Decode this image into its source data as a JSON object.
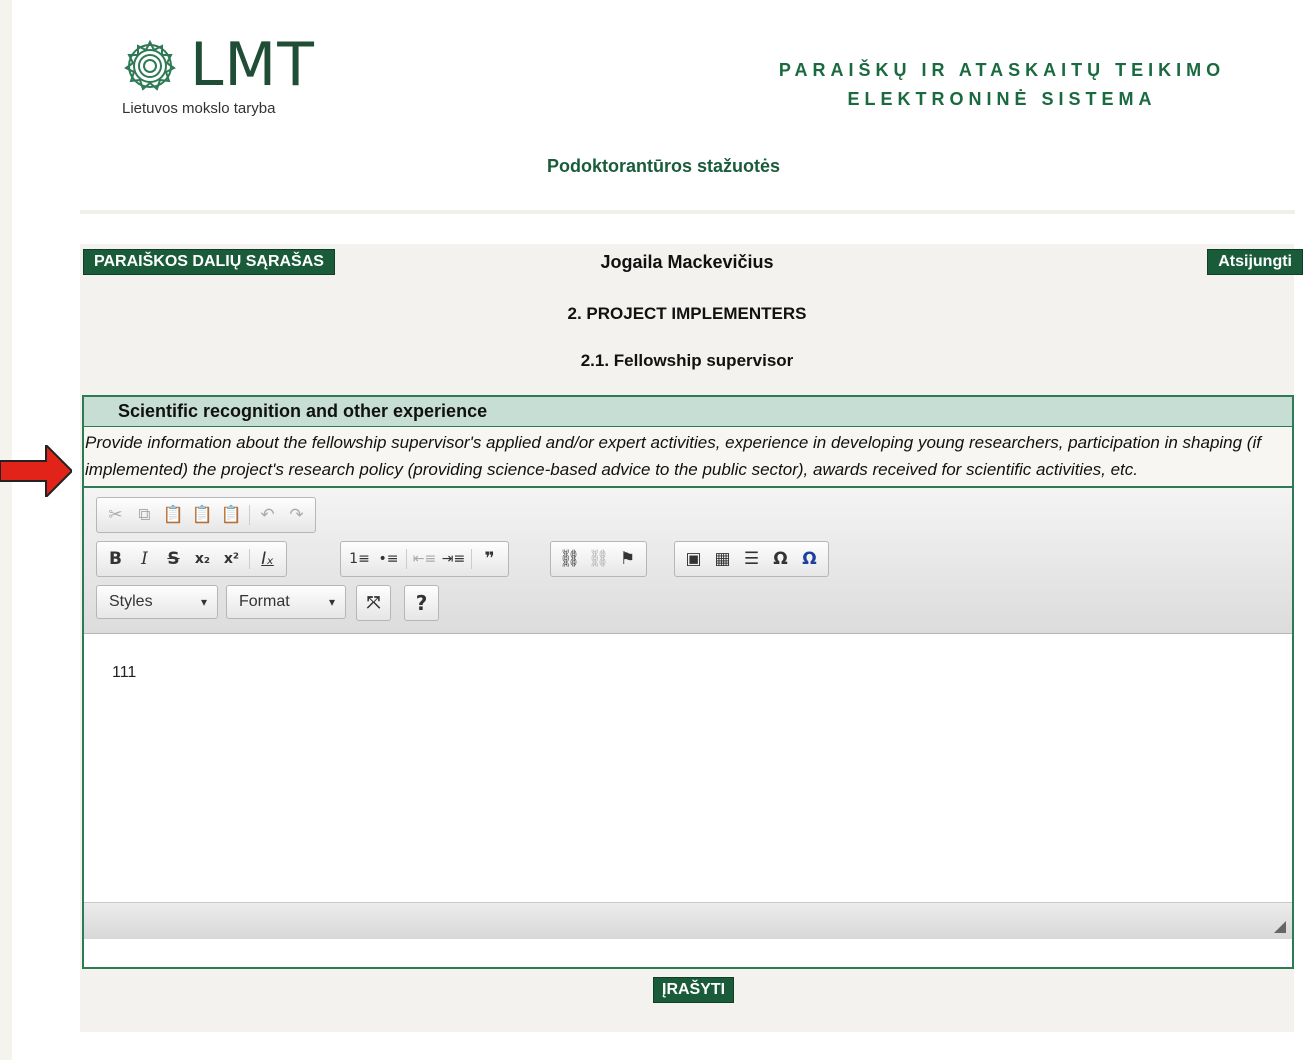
{
  "header": {
    "logo_text": "LMT",
    "logo_subtitle": "Lietuvos mokslo taryba",
    "system_title_line1": "PARAIŠKŲ IR ATASKAITŲ TEIKIMO",
    "system_title_line2": "ELEKTRONINĖ SISTEMA",
    "program_title": "Podoktorantūros stažuotės"
  },
  "nav": {
    "parts_button": "PARAIŠKOS DALIŲ SĄRAŠAS",
    "user_name": "Jogaila Mackevičius",
    "logout_button": "Atsijungti"
  },
  "section": {
    "title": "2. PROJECT IMPLEMENTERS",
    "subtitle": "2.1. Fellowship supervisor"
  },
  "field": {
    "title": "Scientific recognition and other experience",
    "description": "Provide information about the fellowship supervisor's applied and/or expert activities, experience in developing young researchers, participation in shaping (if implemented) the project's research policy (providing science-based advice to the public sector), awards received for scientific activities, etc.",
    "value": "111"
  },
  "editor": {
    "styles_label": "Styles",
    "format_label": "Format",
    "help_label": "?",
    "toolbar_icons": [
      "cut-icon",
      "copy-icon",
      "paste-icon",
      "paste-text-icon",
      "paste-word-icon",
      "undo-icon",
      "redo-icon",
      "bold-icon",
      "italic-icon",
      "strike-icon",
      "subscript-icon",
      "superscript-icon",
      "remove-format-icon",
      "numbered-list-icon",
      "bulleted-list-icon",
      "outdent-icon",
      "indent-icon",
      "blockquote-icon",
      "link-icon",
      "unlink-icon",
      "anchor-icon",
      "image-icon",
      "table-icon",
      "horizontal-line-icon",
      "special-char-icon",
      "special-char-blue-icon",
      "maximize-icon",
      "help-icon"
    ]
  },
  "actions": {
    "save_button": "ĮRAŠYTI"
  },
  "colors": {
    "brand_green": "#1a5c3a",
    "field_header": "#c7ded5",
    "arrow_red": "#e2231a"
  }
}
